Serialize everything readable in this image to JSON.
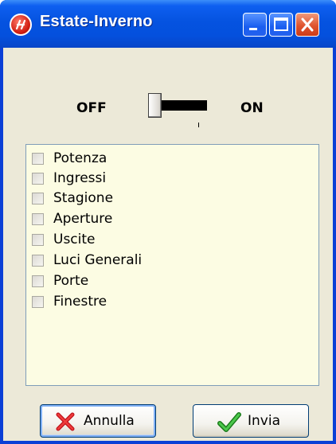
{
  "window": {
    "title": "Estate-Inverno",
    "buttons": [
      "minimize",
      "maximize",
      "close"
    ]
  },
  "switch": {
    "off_label": "OFF",
    "on_label": "ON",
    "state": "OFF"
  },
  "items": [
    {
      "label": "Potenza",
      "checked": false
    },
    {
      "label": "Ingressi",
      "checked": false
    },
    {
      "label": "Stagione",
      "checked": false
    },
    {
      "label": "Aperture",
      "checked": false
    },
    {
      "label": "Uscite",
      "checked": false
    },
    {
      "label": "Luci Generali",
      "checked": false
    },
    {
      "label": "Porte",
      "checked": false
    },
    {
      "label": "Finestre",
      "checked": false
    }
  ],
  "actions": {
    "cancel_label": "Annulla",
    "send_label": "Invia"
  },
  "icons": {
    "app": "app-logo-icon",
    "cancel": "red-x-icon",
    "send": "green-check-icon"
  },
  "colors": {
    "titlebar": "#0553e0",
    "list_background": "#fcfce3",
    "close_button": "#e0542f"
  }
}
